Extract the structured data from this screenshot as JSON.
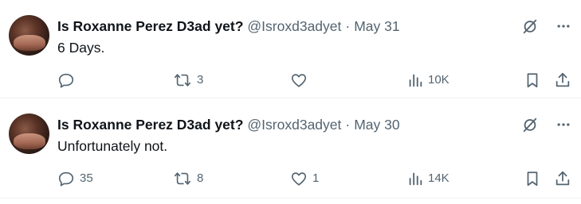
{
  "tweets": [
    {
      "display_name": "Is Roxanne Perez D3ad yet?",
      "handle": "@Isroxd3adyet",
      "separator": "·",
      "date": "May 31",
      "text": "6 Days.",
      "reply_count": "",
      "retweet_count": "3",
      "like_count": "",
      "view_count": "10K"
    },
    {
      "display_name": "Is Roxanne Perez D3ad yet?",
      "handle": "@Isroxd3adyet",
      "separator": "·",
      "date": "May 30",
      "text": "Unfortunately not.",
      "reply_count": "35",
      "retweet_count": "8",
      "like_count": "1",
      "view_count": "14K"
    }
  ],
  "icons": {
    "grok": "grok-icon",
    "more": "more-icon",
    "reply": "reply-icon",
    "retweet": "retweet-icon",
    "like": "like-icon",
    "views": "views-icon",
    "bookmark": "bookmark-icon",
    "share": "share-icon"
  },
  "colors": {
    "text": "#0f1419",
    "secondary": "#536471",
    "divider": "#eff3f4"
  }
}
